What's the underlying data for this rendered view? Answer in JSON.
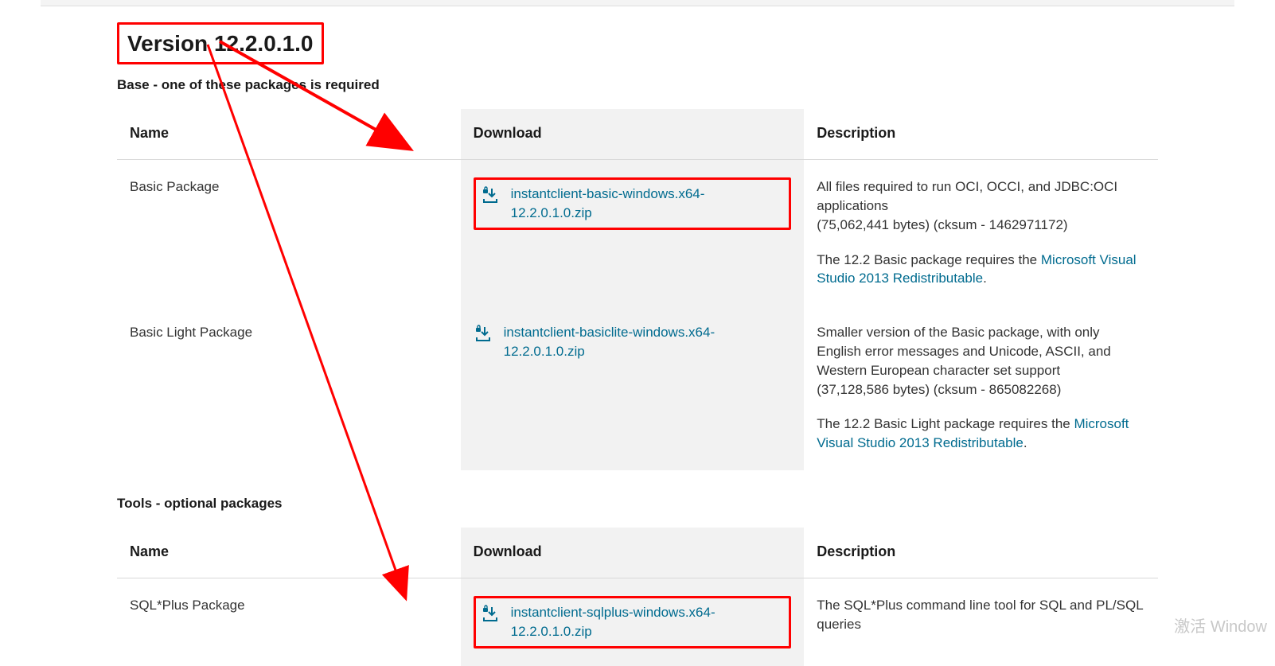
{
  "version_title": "Version 12.2.0.1.0",
  "sections": {
    "base": {
      "subtitle": "Base - one of these packages is required",
      "headers": {
        "name": "Name",
        "download": "Download",
        "description": "Description"
      },
      "rows": [
        {
          "name": "Basic Package",
          "download_label": "instantclient-basic-windows.x64-12.2.0.1.0.zip",
          "desc_line1": "All files required to run OCI, OCCI, and JDBC:OCI applications",
          "desc_line2": "(75,062,441 bytes) (cksum - 1462971172)",
          "desc_line3_prefix": "The 12.2 Basic package requires the ",
          "desc_line3_link": "Microsoft Visual Studio 2013 Redistributable",
          "desc_line3_suffix": "."
        },
        {
          "name": "Basic Light Package",
          "download_label": "instantclient-basiclite-windows.x64-12.2.0.1.0.zip",
          "desc_line1": "Smaller version of the Basic package, with only English error messages and Unicode, ASCII, and Western European character set support",
          "desc_line2": "(37,128,586 bytes) (cksum - 865082268)",
          "desc_line3_prefix": "The 12.2 Basic Light package requires the ",
          "desc_line3_link": "Microsoft Visual Studio 2013 Redistributable",
          "desc_line3_suffix": "."
        }
      ]
    },
    "tools": {
      "subtitle": "Tools - optional packages",
      "headers": {
        "name": "Name",
        "download": "Download",
        "description": "Description"
      },
      "rows": [
        {
          "name": "SQL*Plus Package",
          "download_label": "instantclient-sqlplus-windows.x64-12.2.0.1.0.zip",
          "desc_line1": "The SQL*Plus command line tool for SQL and PL/SQL queries"
        }
      ]
    }
  },
  "watermark": "激活 Window"
}
